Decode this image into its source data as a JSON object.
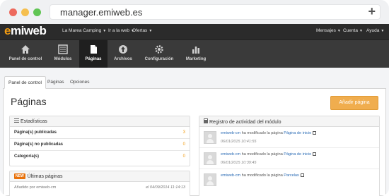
{
  "browser": {
    "url": "manager.emiweb.es",
    "new_tab": "+"
  },
  "topbar": {
    "logo": "emiweb",
    "links": [
      {
        "label": "La Marea Camping"
      },
      {
        "label": "Ir a la web"
      },
      {
        "label": "Ofertas"
      }
    ],
    "right_links": [
      {
        "label": "Mensajes"
      },
      {
        "label": "Cuenta"
      },
      {
        "label": "Ayuda"
      }
    ]
  },
  "mainnav": {
    "items": [
      {
        "label": "Panel de control",
        "icon": "home-icon"
      },
      {
        "label": "Módulos",
        "icon": "grid-icon"
      },
      {
        "label": "Páginas",
        "icon": "page-icon",
        "active": true
      },
      {
        "label": "Archivos",
        "icon": "upload-icon"
      },
      {
        "label": "Configuración",
        "icon": "gear-icon"
      },
      {
        "label": "Marketing",
        "icon": "bar-chart-icon"
      }
    ]
  },
  "subtabs": [
    {
      "label": "Panel de control",
      "active": true
    },
    {
      "label": "Páginas"
    },
    {
      "label": "Opciones"
    }
  ],
  "page": {
    "title": "Páginas",
    "add_button": "Añadir página"
  },
  "stats": {
    "title": "Estadísticas",
    "rows": [
      {
        "label": "Página(s) publicadas",
        "value": "3"
      },
      {
        "label": "Página(s) no publicadas",
        "value": "0"
      },
      {
        "label": "Categoría(s)",
        "value": "0"
      }
    ]
  },
  "latest": {
    "badge": "NEW",
    "title": "Últimas páginas",
    "row": {
      "text": "Añadido por emiweb-cm",
      "date": "el 04/09/2014 11:14:13"
    }
  },
  "activity": {
    "title": "Registro de actividad del módulo",
    "entries": [
      {
        "user": "emiweb-cm",
        "action": "ha modificado la página",
        "page": "Página de inicio",
        "date": "06/01/2015 10:41:55"
      },
      {
        "user": "emiweb-cm",
        "action": "ha modificado la página",
        "page": "Página de inicio",
        "date": "06/01/2015 10:39:45"
      },
      {
        "user": "emiweb-cm",
        "action": "ha modificado la página",
        "page": "Parcelas",
        "date": ""
      }
    ]
  },
  "colors": {
    "accent": "#f0ad4e",
    "topbar": "#2b2b2b",
    "nav": "#3a3a3a",
    "link": "#2a6bb5"
  }
}
